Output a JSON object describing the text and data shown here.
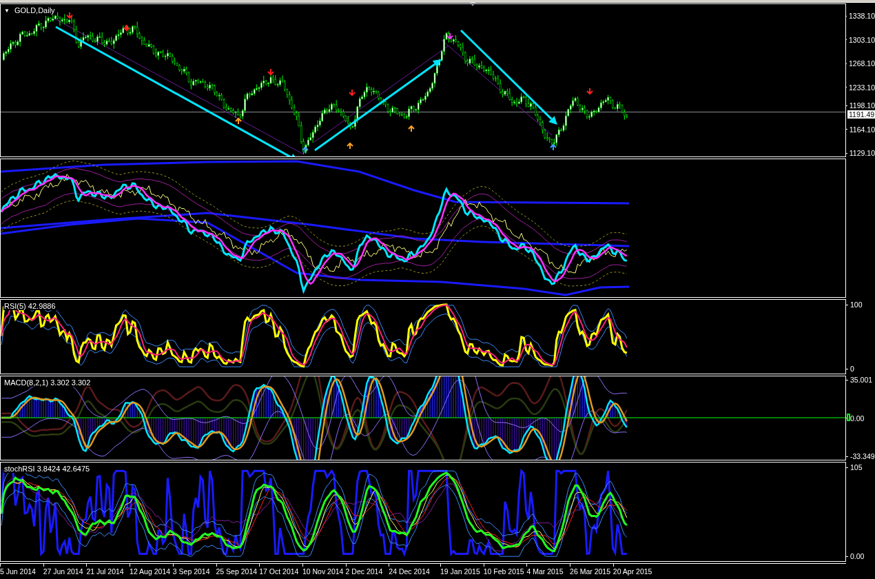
{
  "chart": {
    "title_icon": "▼",
    "symbol": "GOLD,Daily",
    "panes": [
      {
        "kind": "price",
        "axis_labels": [
          "1338.10",
          "1303.10",
          "1268.10",
          "1233.10",
          "1198.10",
          "1164.10",
          "1129.10"
        ],
        "current_price": "1191.49"
      },
      {
        "kind": "overlay"
      },
      {
        "kind": "rsi",
        "title": "RSI(5) 42.9886",
        "axis_labels": [
          "100",
          "0"
        ]
      },
      {
        "kind": "macd",
        "title": "MACD(8,2,1) 3.302 3.302",
        "axis_labels": [
          "35.001",
          "0.00",
          "-33.349"
        ]
      },
      {
        "kind": "stoch",
        "title": "stochRSI 3.8424 42.6475",
        "axis_labels": [
          "105",
          "0.00"
        ]
      }
    ],
    "time_axis": [
      "5 Jun 2014",
      "27 Jun 2014",
      "21 Jul 2014",
      "12 Aug 2014",
      "3 Sep 2014",
      "25 Sep 2014",
      "17 Oct 2014",
      "10 Nov 2014",
      "2 Dec 2014",
      "24 Dec 2014",
      "19 Jan 2015",
      "10 Feb 2015",
      "4 Mar 2015",
      "26 Mar 2015",
      "20 Apr 2015"
    ]
  }
}
